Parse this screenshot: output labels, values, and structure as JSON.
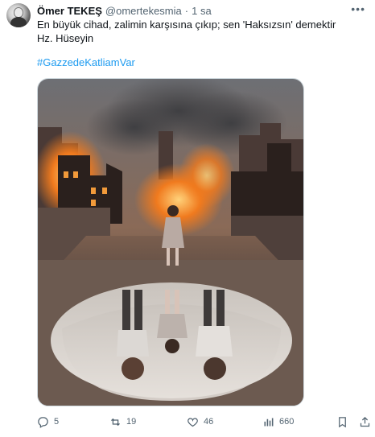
{
  "tweet": {
    "author_name": "Ömer TEKEŞ",
    "author_handle": "@omertekesmia",
    "separator": "·",
    "timestamp": "1 sa",
    "text_line1": "En büyük cihad, zalimin karşısına çıkıp; sen 'Haksızsın' demektir",
    "text_line2": "Hz. Hüseyin",
    "hashtag": "#GazzedeKatliamVar"
  },
  "icons": {
    "more": "more-icon",
    "reply": "reply-icon",
    "retweet": "retweet-icon",
    "like": "heart-icon",
    "views": "views-icon",
    "bookmark": "bookmark-icon",
    "share": "share-icon"
  },
  "metrics": {
    "replies": "5",
    "retweets": "19",
    "likes": "46",
    "views": "660"
  },
  "colors": {
    "accent": "#1d9bf0",
    "muted": "#536471",
    "text": "#0f1419"
  }
}
